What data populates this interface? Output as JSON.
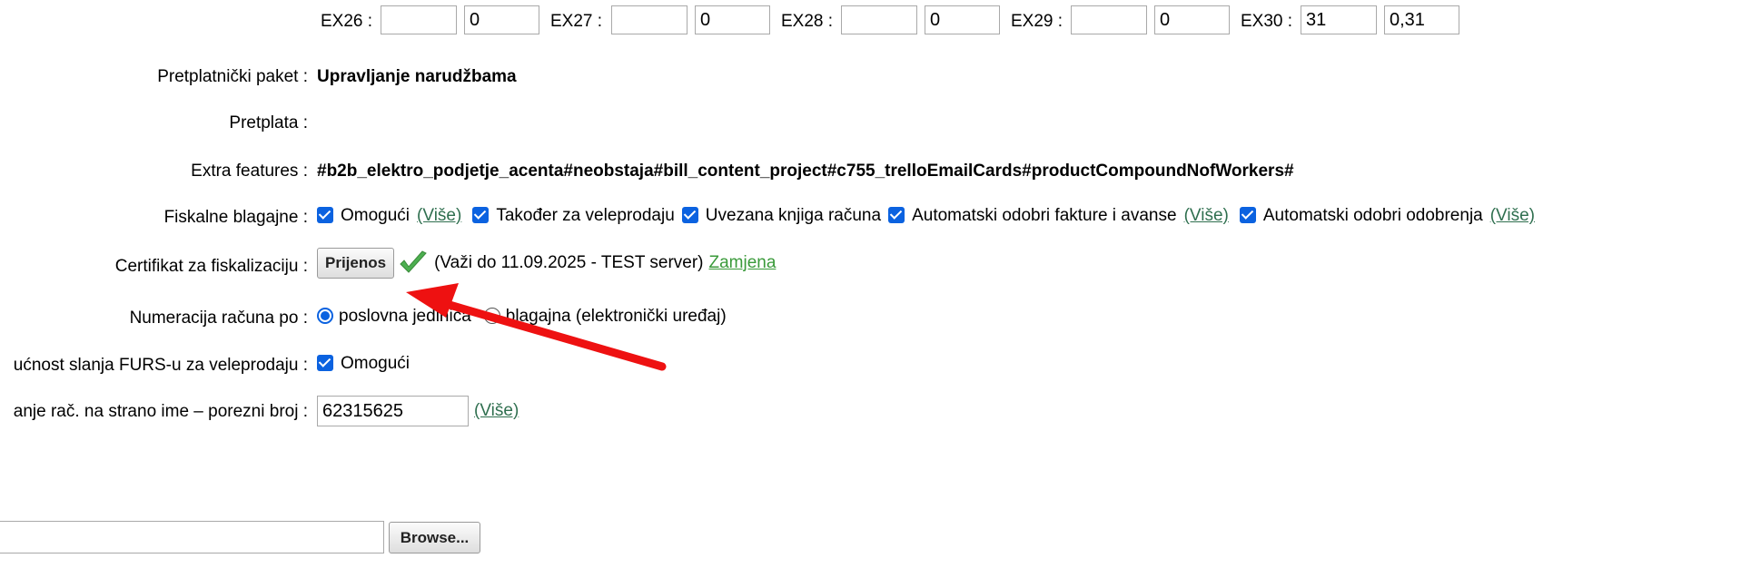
{
  "ex_fields": [
    {
      "label": "EX26 :",
      "value1": "",
      "value2": "0"
    },
    {
      "label": "EX27 :",
      "value1": "",
      "value2": "0"
    },
    {
      "label": "EX28 :",
      "value1": "",
      "value2": "0"
    },
    {
      "label": "EX29 :",
      "value1": "",
      "value2": "0"
    },
    {
      "label": "EX30 :",
      "value1": "31",
      "value2": "0,31"
    }
  ],
  "subscription_package": {
    "label": "Pretplatnički paket :",
    "value": "Upravljanje narudžbama"
  },
  "subscription": {
    "label": "Pretplata :"
  },
  "extra_features": {
    "label": "Extra features :",
    "value": "#b2b_elektro_podjetje_acenta#neobstaja#bill_content_project#c755_trelloEmailCards#productCompoundNofWorkers#"
  },
  "fiscal_registers": {
    "label": "Fiskalne blagajne :",
    "options": [
      {
        "label": "Omogući",
        "checked": true,
        "more": "(Više)"
      },
      {
        "label": "Također za veleprodaju",
        "checked": true
      },
      {
        "label": "Uvezana knjiga računa",
        "checked": true
      },
      {
        "label": "Automatski odobri fakture i avanse",
        "checked": true,
        "more": "(Više)"
      },
      {
        "label": "Automatski odobri odobrenja",
        "checked": true,
        "more": "(Više)"
      }
    ]
  },
  "certificate": {
    "label": "Certifikat za fiskalizaciju :",
    "upload_button": "Prijenos",
    "valid_text": "(Važi do 11.09.2025 - TEST server)",
    "replace_link": "Zamjena"
  },
  "numbering": {
    "label": "Numeracija računa po :",
    "options": [
      {
        "label": "poslovna jedinica",
        "selected": true
      },
      {
        "label": "blagajna (elektronički uređaj)",
        "selected": false
      }
    ]
  },
  "furs_wholesale": {
    "label": "ućnost slanja FURS-u za veleprodaju :",
    "option": "Omogući",
    "checked": true
  },
  "foreign_tax": {
    "label": "anje rač. na strano ime – porezni broj :",
    "value": "62315625",
    "more": "(Više)"
  },
  "file": {
    "value": "",
    "browse_button": "Browse..."
  },
  "annotation_arrow_color": "#ee1111",
  "checkbox_color": "#0b62e0",
  "checkmark_icon_color": "#4caf50"
}
